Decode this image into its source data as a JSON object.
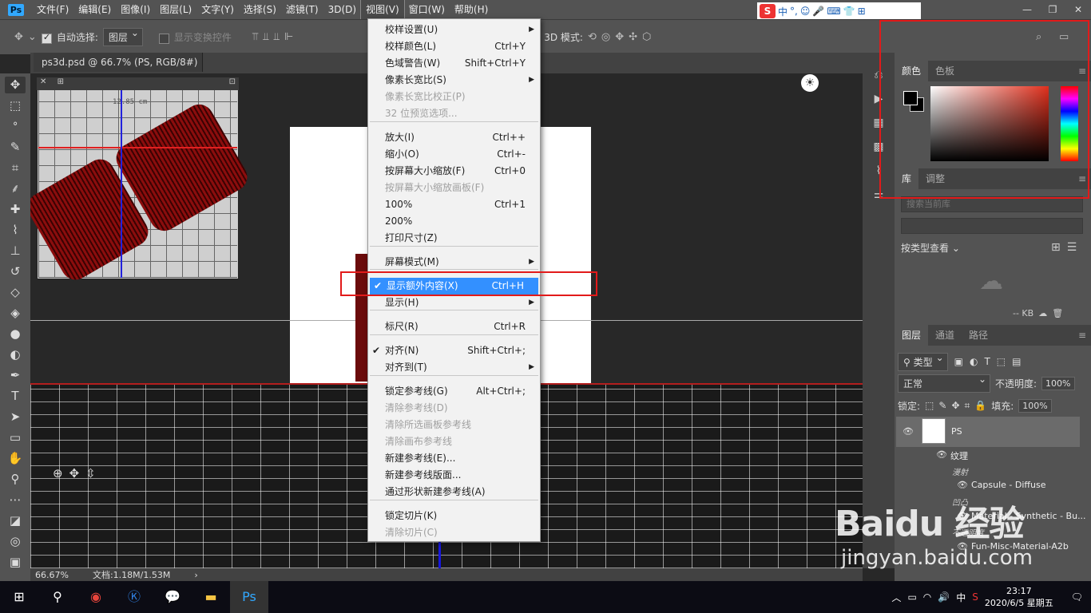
{
  "menubar": {
    "logo": "Ps",
    "items": [
      "文件(F)",
      "编辑(E)",
      "图像(I)",
      "图层(L)",
      "文字(Y)",
      "选择(S)",
      "滤镜(T)",
      "3D(D)",
      "视图(V)",
      "窗口(W)",
      "帮助(H)"
    ],
    "active_index": 8
  },
  "window_controls": [
    "—",
    "❐",
    "✕"
  ],
  "ime": {
    "logo": "S",
    "items": [
      "中",
      "°,",
      "☺",
      "🎤",
      "⌨",
      "👕",
      "⊞"
    ]
  },
  "options": {
    "auto_select_label": "自动选择:",
    "auto_select_value": "图层",
    "show_transform_label": "显示变换控件",
    "mode_3d_label": "3D 模式:"
  },
  "document": {
    "tab_title": "ps3d.psd @ 66.7% (PS, RGB/8#) *",
    "mini_label": "12.85 cm"
  },
  "status": {
    "zoom": "66.67%",
    "doc": "文档:1.18M/1.53M"
  },
  "view_menu": {
    "items": [
      {
        "label": "校样设置(U)",
        "shortcut": "",
        "arrow": true,
        "disabled": false
      },
      {
        "label": "校样颜色(L)",
        "shortcut": "Ctrl+Y",
        "disabled": false
      },
      {
        "label": "色域警告(W)",
        "shortcut": "Shift+Ctrl+Y",
        "disabled": false
      },
      {
        "label": "像素长宽比(S)",
        "shortcut": "",
        "arrow": true,
        "disabled": false
      },
      {
        "label": "像素长宽比校正(P)",
        "shortcut": "",
        "disabled": true
      },
      {
        "label": "32 位预览选项...",
        "shortcut": "",
        "disabled": true
      },
      {
        "label": "放大(I)",
        "shortcut": "Ctrl++",
        "disabled": false
      },
      {
        "label": "缩小(O)",
        "shortcut": "Ctrl+-",
        "disabled": false
      },
      {
        "label": "按屏幕大小缩放(F)",
        "shortcut": "Ctrl+0",
        "disabled": false
      },
      {
        "label": "按屏幕大小缩放画板(F)",
        "shortcut": "",
        "disabled": true
      },
      {
        "label": "100%",
        "shortcut": "Ctrl+1",
        "disabled": false
      },
      {
        "label": "200%",
        "shortcut": "",
        "disabled": false
      },
      {
        "label": "打印尺寸(Z)",
        "shortcut": "",
        "disabled": false
      },
      {
        "label": "屏幕模式(M)",
        "shortcut": "",
        "arrow": true,
        "disabled": false
      },
      {
        "label": "显示额外内容(X)",
        "shortcut": "Ctrl+H",
        "checked": true,
        "highlighted": true,
        "disabled": false
      },
      {
        "label": "显示(H)",
        "shortcut": "",
        "arrow": true,
        "disabled": false
      },
      {
        "label": "标尺(R)",
        "shortcut": "Ctrl+R",
        "disabled": false
      },
      {
        "label": "对齐(N)",
        "shortcut": "Shift+Ctrl+;",
        "checked": true,
        "disabled": false
      },
      {
        "label": "对齐到(T)",
        "shortcut": "",
        "arrow": true,
        "disabled": false
      },
      {
        "label": "锁定参考线(G)",
        "shortcut": "Alt+Ctrl+;",
        "disabled": false
      },
      {
        "label": "清除参考线(D)",
        "shortcut": "",
        "disabled": true
      },
      {
        "label": "清除所选画板参考线",
        "shortcut": "",
        "disabled": true
      },
      {
        "label": "清除画布参考线",
        "shortcut": "",
        "disabled": true
      },
      {
        "label": "新建参考线(E)...",
        "shortcut": "",
        "disabled": false
      },
      {
        "label": "新建参考线版面...",
        "shortcut": "",
        "disabled": false
      },
      {
        "label": "通过形状新建参考线(A)",
        "shortcut": "",
        "disabled": false
      },
      {
        "label": "锁定切片(K)",
        "shortcut": "",
        "disabled": false
      },
      {
        "label": "清除切片(C)",
        "shortcut": "",
        "disabled": true
      }
    ]
  },
  "color_panel": {
    "tabs": [
      "颜色",
      "色板"
    ]
  },
  "library_panel": {
    "tabs": [
      "库",
      "调整"
    ],
    "search_placeholder": "搜索当前库",
    "view_label": "按类型查看",
    "size": "-- KB"
  },
  "layers_panel": {
    "tabs": [
      "图层",
      "通道",
      "路径"
    ],
    "filter": "类型",
    "blend": "正常",
    "opacity_label": "不透明度:",
    "opacity": "100%",
    "lock_label": "锁定:",
    "fill_label": "填充:",
    "fill": "100%",
    "layer_name": "PS",
    "texture_label": "纹理",
    "diffuse_group": "漫射",
    "diffuse_item": "Capsule - Diffuse",
    "bump_group": "凹凸",
    "bump_item": "Material - Synthetic - Bu...",
    "opacity_group": "不透明度",
    "opacity_item": "Fun-Misc-Material-A2b"
  },
  "watermark": {
    "big": "Baidu 经验",
    "small": "jingyan.baidu.com"
  },
  "taskbar": {
    "time": "23:17",
    "date": "2020/6/5 星期五",
    "lang": "中"
  }
}
